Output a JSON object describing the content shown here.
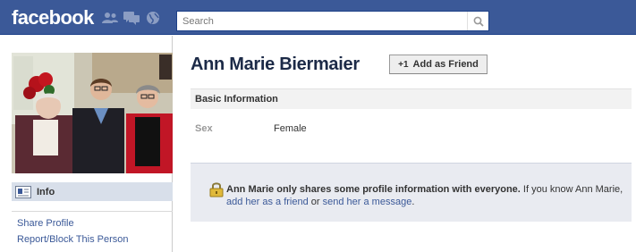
{
  "topbar": {
    "logo": "facebook",
    "icons": [
      "friend-requests-icon",
      "messages-icon",
      "notifications-globe-icon",
      "search-icon"
    ],
    "search": {
      "placeholder": "Search",
      "value": ""
    }
  },
  "profile": {
    "name": "Ann Marie Biermaier",
    "add_friend_plus": "+1",
    "add_friend_label": "Add as Friend"
  },
  "sidebar": {
    "info_tab": "Info",
    "links": [
      "Share Profile",
      "Report/Block This Person"
    ]
  },
  "basic_info": {
    "header": "Basic Information",
    "fields": [
      {
        "label": "Sex",
        "value": "Female"
      }
    ]
  },
  "notice": {
    "bold": "Ann Marie only shares some profile information with everyone.",
    "text1": " If you know Ann Marie, ",
    "link1": "add her as a friend",
    "text2": " or ",
    "link2": "send her a message",
    "text3": "."
  },
  "colors": {
    "brand_blue": "#3b5998",
    "header_gray": "#f2f2f2",
    "notice_bg": "#e9ebf1",
    "tab_bg": "#d8dfea"
  }
}
